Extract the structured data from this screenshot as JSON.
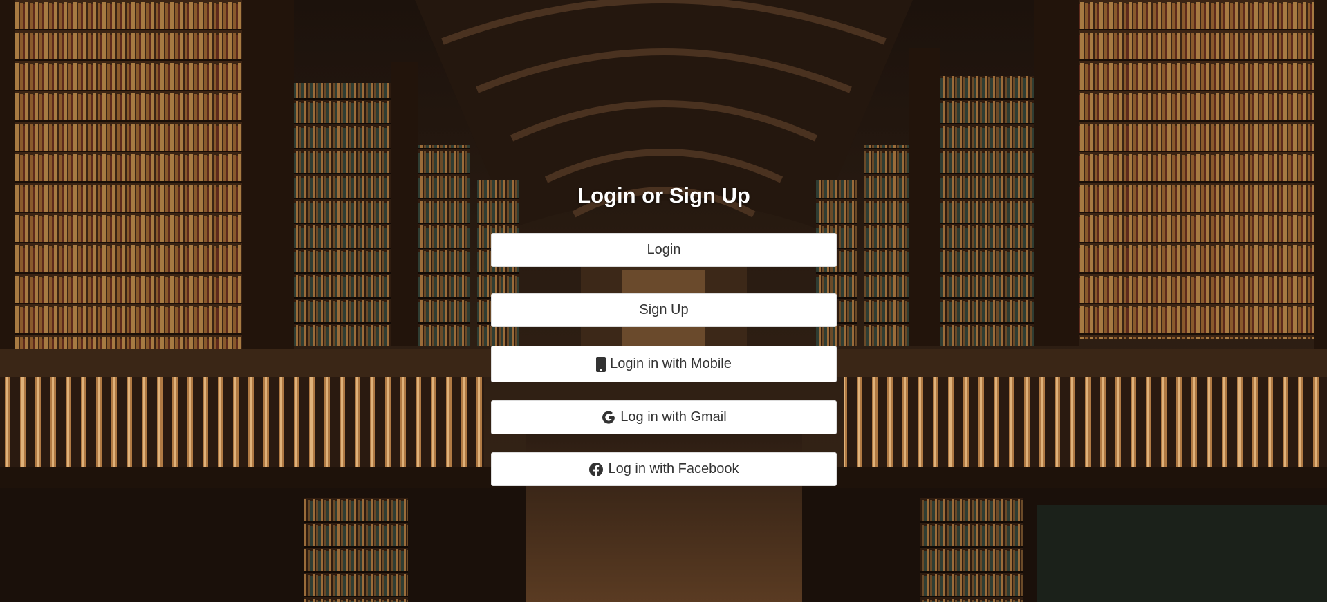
{
  "page": {
    "title": "Login or Sign Up"
  },
  "buttons": {
    "login": "Login",
    "signup": "Sign Up",
    "mobile": "Login in with Mobile",
    "gmail": "Log in with Gmail",
    "facebook": "Log in with Facebook"
  },
  "icons": {
    "mobile": "mobile-phone-icon",
    "gmail": "google-icon",
    "facebook": "facebook-icon"
  },
  "colors": {
    "title_text": "#ffffff",
    "button_bg": "#ffffff",
    "button_text": "#333333"
  }
}
